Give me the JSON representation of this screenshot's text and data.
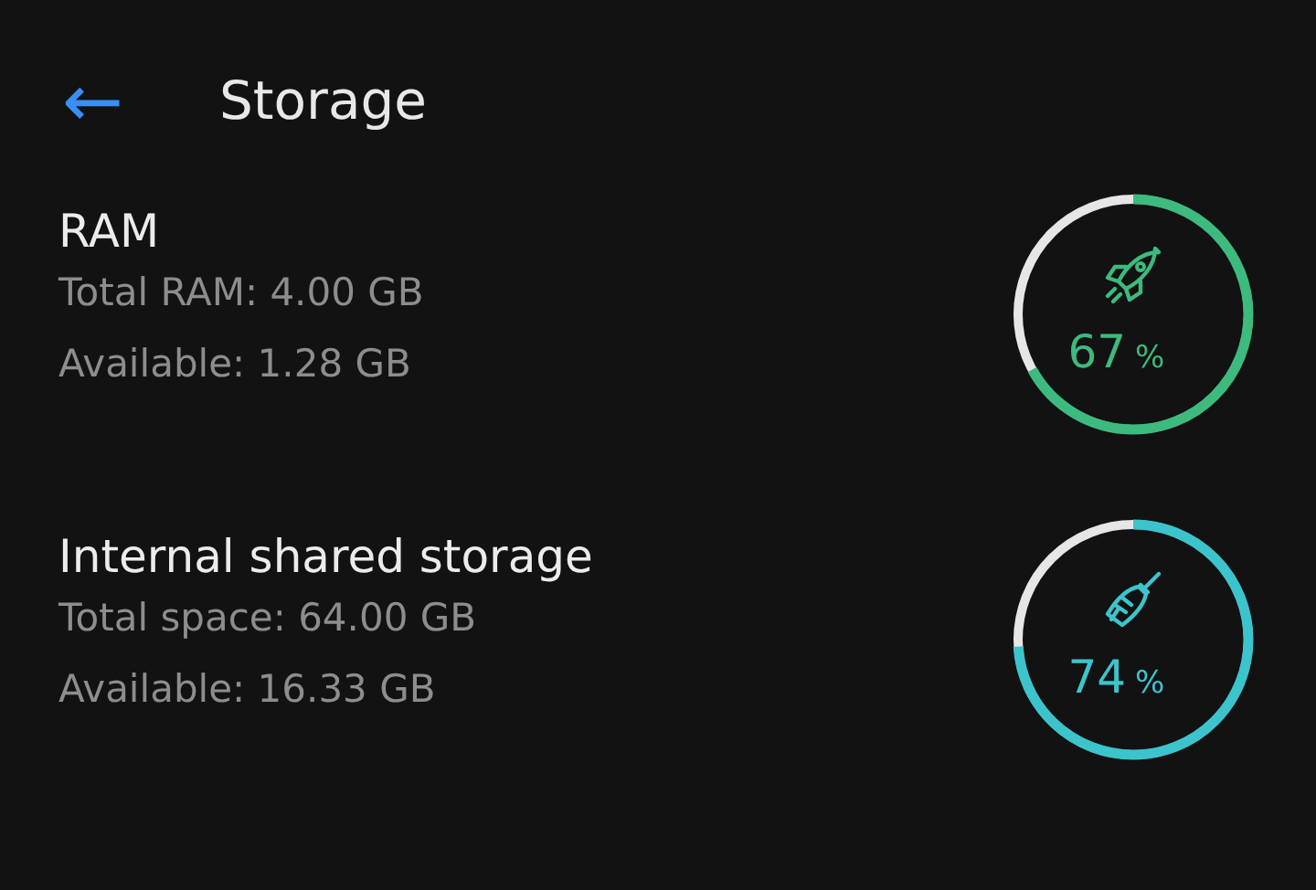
{
  "header": {
    "back_icon": "←",
    "title": "Storage"
  },
  "sections": [
    {
      "title": "RAM",
      "lines": [
        "Total RAM: 4.00 GB",
        "Available: 1.28 GB"
      ],
      "gauge": {
        "kind": "rocket",
        "level": 0.67,
        "percent": "67",
        "unit": "%",
        "color": "#3dba7e"
      }
    },
    {
      "title": "Internal shared storage",
      "lines": [
        "Total space: 64.00 GB",
        "Available: 16.33 GB"
      ],
      "gauge": {
        "kind": "broom",
        "level": 0.74,
        "percent": "74",
        "unit": "%",
        "color": "#3cc4cc"
      }
    }
  ]
}
